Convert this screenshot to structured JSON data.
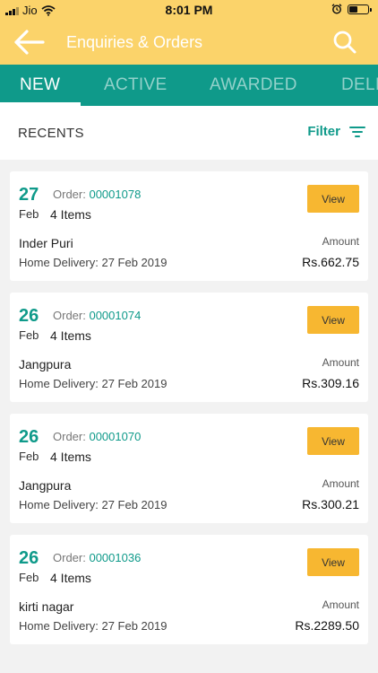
{
  "status_bar": {
    "carrier": "Jio",
    "time": "8:01 PM"
  },
  "header": {
    "title": "Enquiries & Orders",
    "back_icon": "back-arrow-icon",
    "search_icon": "search-icon",
    "color": "#fbd36a"
  },
  "tabs": [
    {
      "label": "NEW",
      "active": true
    },
    {
      "label": "ACTIVE",
      "active": false
    },
    {
      "label": "AWARDED",
      "active": false
    },
    {
      "label": "DELI",
      "active": false
    }
  ],
  "recents": {
    "label": "RECENTS",
    "filter_label": "Filter"
  },
  "colors": {
    "accent": "#0f9a8a",
    "button": "#f7b731"
  },
  "orders": [
    {
      "day": "27",
      "month": "Feb",
      "order_prefix": "Order: ",
      "order_number": "00001078",
      "items": "4 Items",
      "view_label": "View",
      "location": "Inder Puri",
      "delivery": "Home Delivery: 27 Feb 2019",
      "amount_label": "Amount",
      "amount": "Rs.662.75"
    },
    {
      "day": "26",
      "month": "Feb",
      "order_prefix": "Order: ",
      "order_number": "00001074",
      "items": "4 Items",
      "view_label": "View",
      "location": "Jangpura",
      "delivery": "Home Delivery: 27 Feb 2019",
      "amount_label": "Amount",
      "amount": "Rs.309.16"
    },
    {
      "day": "26",
      "month": "Feb",
      "order_prefix": "Order: ",
      "order_number": "00001070",
      "items": "4 Items",
      "view_label": "View",
      "location": "Jangpura",
      "delivery": "Home Delivery: 27 Feb 2019",
      "amount_label": "Amount",
      "amount": "Rs.300.21"
    },
    {
      "day": "26",
      "month": "Feb",
      "order_prefix": "Order: ",
      "order_number": "00001036",
      "items": "4 Items",
      "view_label": "View",
      "location": "kirti nagar",
      "delivery": "Home Delivery: 27 Feb 2019",
      "amount_label": "Amount",
      "amount": "Rs.2289.50"
    }
  ]
}
